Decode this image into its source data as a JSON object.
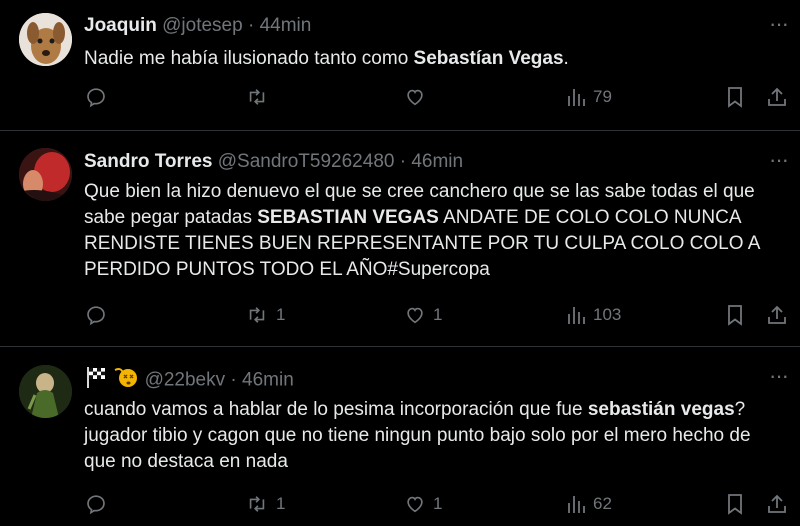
{
  "tweets": [
    {
      "name": "Joaquin",
      "handle": "@jotesep",
      "sep": "·",
      "time": "44min",
      "text": [
        {
          "t": "Nadie me había ilusionado tanto como ",
          "b": false
        },
        {
          "t": "Sebastían Vegas",
          "b": true
        },
        {
          "t": ".",
          "b": false
        }
      ],
      "replies": "",
      "retweets": "",
      "likes": "",
      "views": "79"
    },
    {
      "name": "Sandro Torres",
      "handle": "@SandroT59262480",
      "sep": "·",
      "time": "46min",
      "text": [
        {
          "t": "Que bien la hizo denuevo el que se cree canchero que se las sabe todas el que sabe pegar patadas ",
          "b": false
        },
        {
          "t": "SEBASTIAN VEGAS",
          "b": true
        },
        {
          "t": " ANDATE DE COLO COLO NUNCA RENDISTE TIENES BUEN REPRESENTANTE POR TU CULPA COLO COLO A PERDIDO PUNTOS TODO EL AÑO#Supercopa",
          "b": false
        }
      ],
      "replies": "",
      "retweets": "1",
      "likes": "1",
      "views": "103"
    },
    {
      "name": "",
      "handle": "@22bekv",
      "sep": "·",
      "time": "46min",
      "emoji_names": [
        "checkered-flag-icon",
        "dizzy-face-icon"
      ],
      "text": [
        {
          "t": "cuando vamos a hablar de lo pesima incorporación que fue ",
          "b": false
        },
        {
          "t": "sebastián vegas",
          "b": true
        },
        {
          "t": "? jugador tibio y cagon que no tiene ningun punto bajo solo por el mero hecho de que no destaca en nada",
          "b": false
        }
      ],
      "replies": "",
      "retweets": "1",
      "likes": "1",
      "views": "62"
    }
  ],
  "colors": {
    "background": "#000000",
    "text": "#e7e9ea",
    "muted": "#71767b",
    "divider": "#2f3336"
  }
}
